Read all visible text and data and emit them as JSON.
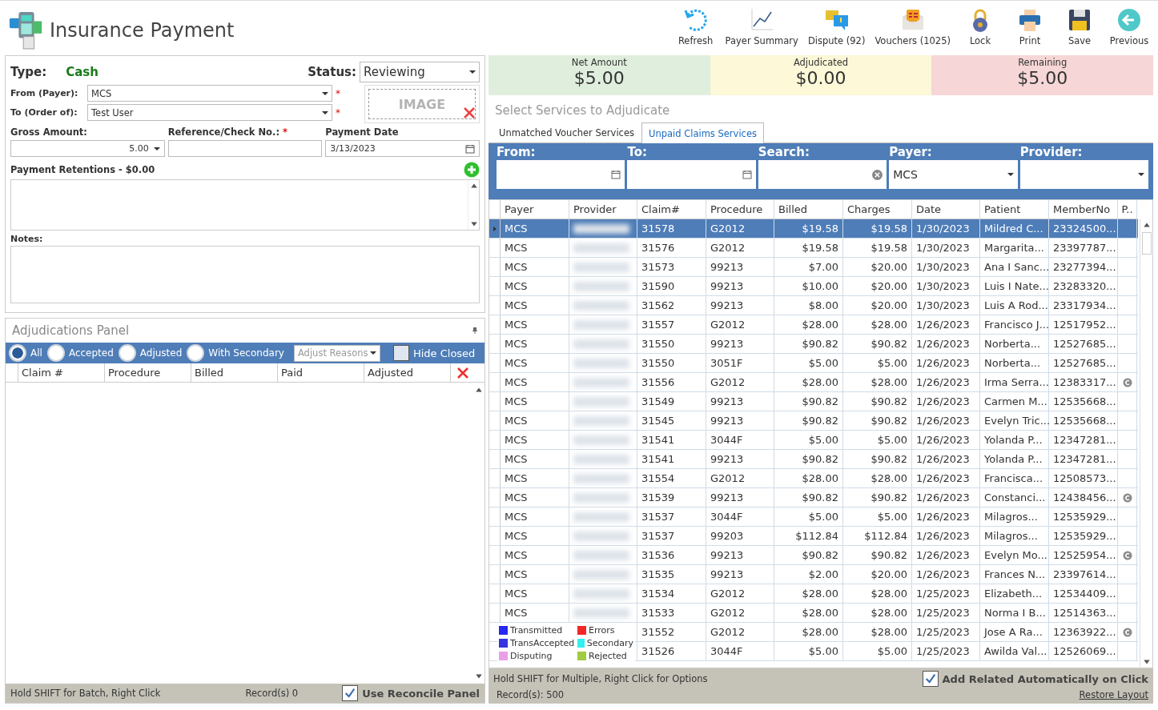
{
  "title": "Insurance Payment",
  "toolbar": [
    {
      "kind": "refresh",
      "label": "Refresh"
    },
    {
      "kind": "chart",
      "label": "Payer Summary"
    },
    {
      "kind": "dispute",
      "label": "Dispute (92)"
    },
    {
      "kind": "voucher",
      "label": "Vouchers (1025)"
    },
    {
      "kind": "lock",
      "label": "Lock"
    },
    {
      "kind": "print",
      "label": "Print"
    },
    {
      "kind": "save",
      "label": "Save"
    },
    {
      "kind": "back",
      "label": "Previous"
    }
  ],
  "form": {
    "type_label": "Type:",
    "type_value": "Cash",
    "status_label": "Status:",
    "status_value": "Reviewing",
    "from_label": "From (Payer):",
    "from_value": "MCS",
    "to_label": "To (Order of):",
    "to_value": "Test User",
    "required_mark": "*",
    "image_label": "IMAGE",
    "gross_label": "Gross Amount:",
    "gross_value": "5.00",
    "reference_label": "Reference/Check No.:",
    "date_label": "Payment Date",
    "date_value": "3/13/2023",
    "retentions_label": "Payment Retentions - $0.00",
    "notes_label": "Notes:"
  },
  "adjudications": {
    "title": "Adjudications Panel",
    "filters": [
      {
        "label": "All",
        "selected": true
      },
      {
        "label": "Accepted",
        "selected": false
      },
      {
        "label": "Adjusted",
        "selected": false
      },
      {
        "label": "With Secondary",
        "selected": false
      }
    ],
    "reasons_placeholder": "Adjust Reasons",
    "hide_closed": {
      "label": "Hide Closed",
      "checked": false
    },
    "columns": [
      "Claim #",
      "Procedure",
      "Billed",
      "Paid",
      "Adjusted"
    ]
  },
  "left_status": {
    "hint": "Hold SHIFT for Batch, Right Click",
    "records": "Record(s) 0",
    "reconcile": {
      "label": "Use Reconcile Panel",
      "checked": true
    }
  },
  "summary": [
    {
      "label": "Net Amount",
      "value": "$5.00",
      "color": "#e0eedd"
    },
    {
      "label": "Adjudicated",
      "value": "$0.00",
      "color": "#fcf8d8"
    },
    {
      "label": "Remaining",
      "value": "$5.00",
      "color": "#f6d6d6"
    }
  ],
  "section_title": "Select Services to Adjudicate",
  "tabs": [
    {
      "label": "Unmatched Voucher Services",
      "selected": false
    },
    {
      "label": "Unpaid Claims Services",
      "selected": true
    }
  ],
  "filters": [
    {
      "label": "From:",
      "kind": "date"
    },
    {
      "label": "To:",
      "kind": "date"
    },
    {
      "label": "Search:",
      "kind": "search"
    },
    {
      "label": "Payer:",
      "kind": "select",
      "value": "MCS"
    },
    {
      "label": "Provider:",
      "kind": "select"
    }
  ],
  "columns": [
    "Payer",
    "Provider",
    "Claim#",
    "Procedure",
    "Billed",
    "Charges",
    "Date",
    "Patient",
    "MemberNo",
    "P.."
  ],
  "rows": [
    {
      "payer": "MCS",
      "claim": "31578",
      "procedure": "G2012",
      "billed": "$19.58",
      "charges": "$19.58",
      "date": "1/30/2023",
      "patient": "Mildred C...",
      "member": "23324500...",
      "flag": false,
      "selected": true
    },
    {
      "payer": "MCS",
      "claim": "31576",
      "procedure": "G2012",
      "billed": "$19.58",
      "charges": "$19.58",
      "date": "1/30/2023",
      "patient": "Margarita...",
      "member": "23397787...",
      "flag": false,
      "selected": false
    },
    {
      "payer": "MCS",
      "claim": "31573",
      "procedure": "99213",
      "billed": "$7.00",
      "charges": "$20.00",
      "date": "1/30/2023",
      "patient": "Ana I Sanc...",
      "member": "23277394...",
      "flag": false,
      "selected": false
    },
    {
      "payer": "MCS",
      "claim": "31590",
      "procedure": "99213",
      "billed": "$10.00",
      "charges": "$20.00",
      "date": "1/30/2023",
      "patient": "Luis I Nate...",
      "member": "23283320...",
      "flag": false,
      "selected": false
    },
    {
      "payer": "MCS",
      "claim": "31562",
      "procedure": "99213",
      "billed": "$8.00",
      "charges": "$20.00",
      "date": "1/30/2023",
      "patient": "Luis A Rod...",
      "member": "23317934...",
      "flag": false,
      "selected": false
    },
    {
      "payer": "MCS",
      "claim": "31557",
      "procedure": "G2012",
      "billed": "$28.00",
      "charges": "$28.00",
      "date": "1/26/2023",
      "patient": "Francisco J...",
      "member": "12517952...",
      "flag": false,
      "selected": false
    },
    {
      "payer": "MCS",
      "claim": "31550",
      "procedure": "99213",
      "billed": "$90.82",
      "charges": "$90.82",
      "date": "1/26/2023",
      "patient": "Norberta...",
      "member": "12527685...",
      "flag": false,
      "selected": false
    },
    {
      "payer": "MCS",
      "claim": "31550",
      "procedure": "3051F",
      "billed": "$5.00",
      "charges": "$5.00",
      "date": "1/26/2023",
      "patient": "Norberta...",
      "member": "12527685...",
      "flag": false,
      "selected": false
    },
    {
      "payer": "MCS",
      "claim": "31556",
      "procedure": "G2012",
      "billed": "$28.00",
      "charges": "$28.00",
      "date": "1/26/2023",
      "patient": "Irma Serra...",
      "member": "12383317...",
      "flag": true,
      "selected": false
    },
    {
      "payer": "MCS",
      "claim": "31549",
      "procedure": "99213",
      "billed": "$90.82",
      "charges": "$90.82",
      "date": "1/26/2023",
      "patient": "Carmen M...",
      "member": "12535668...",
      "flag": false,
      "selected": false
    },
    {
      "payer": "MCS",
      "claim": "31545",
      "procedure": "99213",
      "billed": "$90.82",
      "charges": "$90.82",
      "date": "1/26/2023",
      "patient": "Evelyn Tric...",
      "member": "12535668...",
      "flag": false,
      "selected": false
    },
    {
      "payer": "MCS",
      "claim": "31541",
      "procedure": "3044F",
      "billed": "$5.00",
      "charges": "$5.00",
      "date": "1/26/2023",
      "patient": "Yolanda P...",
      "member": "12347281...",
      "flag": false,
      "selected": false
    },
    {
      "payer": "MCS",
      "claim": "31541",
      "procedure": "99213",
      "billed": "$90.82",
      "charges": "$90.82",
      "date": "1/26/2023",
      "patient": "Yolanda P...",
      "member": "12347281...",
      "flag": false,
      "selected": false
    },
    {
      "payer": "MCS",
      "claim": "31554",
      "procedure": "G2012",
      "billed": "$28.00",
      "charges": "$28.00",
      "date": "1/26/2023",
      "patient": "Francisca...",
      "member": "12508573...",
      "flag": false,
      "selected": false
    },
    {
      "payer": "MCS",
      "claim": "31539",
      "procedure": "99213",
      "billed": "$90.82",
      "charges": "$90.82",
      "date": "1/26/2023",
      "patient": "Constanci...",
      "member": "12438456...",
      "flag": true,
      "selected": false
    },
    {
      "payer": "MCS",
      "claim": "31537",
      "procedure": "3044F",
      "billed": "$5.00",
      "charges": "$5.00",
      "date": "1/26/2023",
      "patient": "Milagros...",
      "member": "12535929...",
      "flag": false,
      "selected": false
    },
    {
      "payer": "MCS",
      "claim": "31537",
      "procedure": "99203",
      "billed": "$112.84",
      "charges": "$112.84",
      "date": "1/26/2023",
      "patient": "Milagros...",
      "member": "12535929...",
      "flag": false,
      "selected": false
    },
    {
      "payer": "MCS",
      "claim": "31536",
      "procedure": "99213",
      "billed": "$90.82",
      "charges": "$90.82",
      "date": "1/26/2023",
      "patient": "Evelyn Mo...",
      "member": "12525954...",
      "flag": true,
      "selected": false
    },
    {
      "payer": "MCS",
      "claim": "31535",
      "procedure": "99213",
      "billed": "$2.00",
      "charges": "$20.00",
      "date": "1/26/2023",
      "patient": "Frances N...",
      "member": "23397614...",
      "flag": false,
      "selected": false
    },
    {
      "payer": "MCS",
      "claim": "31534",
      "procedure": "G2012",
      "billed": "$28.00",
      "charges": "$28.00",
      "date": "1/25/2023",
      "patient": "Elizabeth...",
      "member": "12534409...",
      "flag": false,
      "selected": false
    },
    {
      "payer": "MCS",
      "claim": "31533",
      "procedure": "G2012",
      "billed": "$28.00",
      "charges": "$28.00",
      "date": "1/25/2023",
      "patient": "Norma I B...",
      "member": "12514363...",
      "flag": false,
      "selected": false
    },
    {
      "claim": "31552",
      "procedure": "G2012",
      "billed": "$28.00",
      "charges": "$28.00",
      "date": "1/25/2023",
      "patient": "Jose A Ra...",
      "member": "12363922...",
      "flag": true,
      "selected": false
    },
    {
      "claim": "31526",
      "procedure": "3044F",
      "billed": "$5.00",
      "charges": "$5.00",
      "date": "1/25/2023",
      "patient": "Awilda Val...",
      "member": "12526069...",
      "flag": false,
      "selected": false
    }
  ],
  "legend": [
    {
      "label": "Transmitted",
      "color": "#2828f0"
    },
    {
      "label": "Errors",
      "color": "#f02828"
    },
    {
      "label": "TransAccepted",
      "color": "#3434e0"
    },
    {
      "label": "Secondary",
      "color": "#30f0f0"
    },
    {
      "label": "Disputing",
      "color": "#e8a0e8"
    },
    {
      "label": "Rejected",
      "color": "#a0cc40"
    }
  ],
  "right_status": {
    "hint": "Hold SHIFT for Multiple, Right Click for Options",
    "records": "Record(s): 500",
    "auto": {
      "label": "Add Related Automatically on Click",
      "checked": true
    },
    "restore": "Restore Layout"
  }
}
